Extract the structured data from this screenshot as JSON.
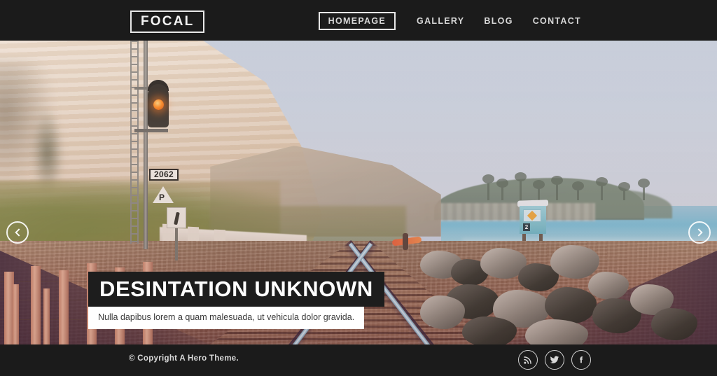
{
  "site": {
    "logo": "FOCAL"
  },
  "nav": {
    "items": [
      {
        "label": "HOMEPAGE",
        "active": true
      },
      {
        "label": "GALLERY",
        "active": false
      },
      {
        "label": "BLOG",
        "active": false
      },
      {
        "label": "CONTACT",
        "active": false
      }
    ]
  },
  "hero": {
    "title": "DESINTATION UNKNOWN",
    "subtitle": "Nulla dapibus lorem a quam malesuada, ut vehicula dolor gravida.",
    "prev_label": "‹",
    "next_label": "›",
    "scene": {
      "signal_number": "2062",
      "parking_sign": "P",
      "lifeguard_tower_number": "2"
    }
  },
  "footer": {
    "copyright": "© Copyright A Hero Theme.",
    "socials": [
      {
        "name": "rss",
        "label": "RSS"
      },
      {
        "name": "twitter",
        "label": "Twitter"
      },
      {
        "name": "facebook",
        "label": "Facebook"
      }
    ]
  },
  "colors": {
    "bar_dark": "#1b1b1b",
    "text_light": "#f2f2f2",
    "caption_bg": "#1d1d1d",
    "caption_sub_bg": "#ffffff",
    "sky": "#ccd4e0",
    "signal_lamp": "#ff8a20"
  }
}
